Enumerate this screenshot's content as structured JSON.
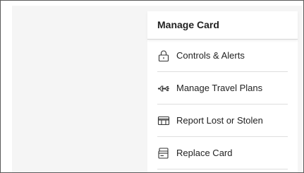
{
  "panel": {
    "title": "Manage Card",
    "items": [
      {
        "label": "Controls & Alerts",
        "icon": "lock-icon"
      },
      {
        "label": "Manage Travel Plans",
        "icon": "airplane-icon"
      },
      {
        "label": "Report Lost or Stolen",
        "icon": "card-icon"
      },
      {
        "label": "Replace Card",
        "icon": "replace-card-icon"
      }
    ]
  }
}
